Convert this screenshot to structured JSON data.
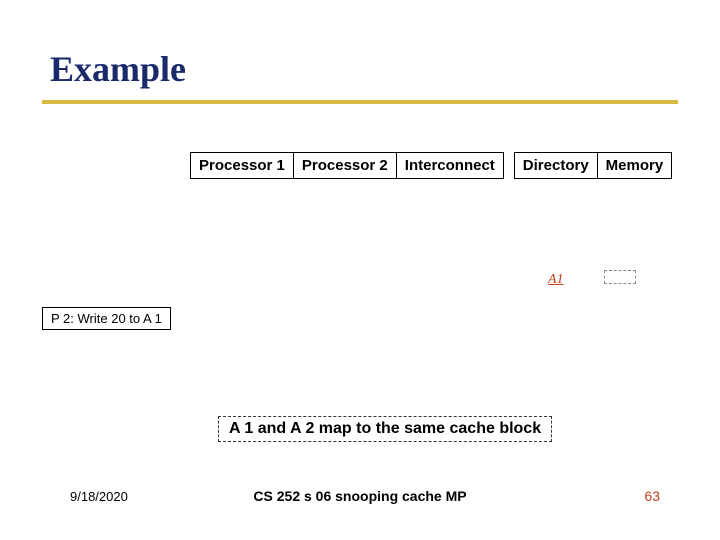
{
  "title": "Example",
  "headers": {
    "proc1": "Processor 1",
    "proc2": "Processor 2",
    "interconnect": "Interconnect",
    "directory": "Directory",
    "memory": "Memory"
  },
  "a1_label": "A1",
  "p2_action": "P 2: Write 20 to A 1",
  "note": "A 1 and A 2 map to the same cache block",
  "footer": {
    "date": "9/18/2020",
    "center": "CS 252 s 06 snooping cache MP",
    "page": "63"
  }
}
